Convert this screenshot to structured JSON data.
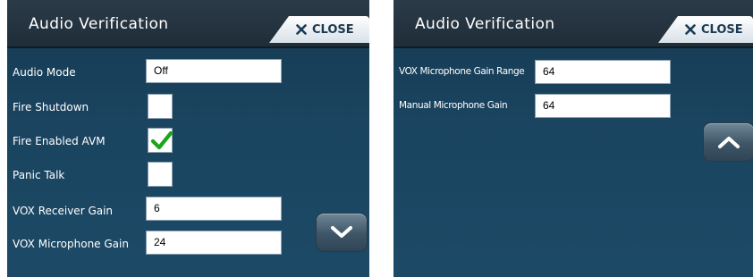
{
  "left_panel": {
    "title": "Audio Verification",
    "close_label": "CLOSE",
    "rows": [
      {
        "label": "Audio Mode",
        "value": "Off"
      },
      {
        "label": "Fire Shutdown",
        "checked": false
      },
      {
        "label": "Fire Enabled AVM",
        "checked": true
      },
      {
        "label": "Panic Talk",
        "checked": false
      },
      {
        "label": "VOX Receiver Gain",
        "value": "6"
      },
      {
        "label": "VOX Microphone Gain",
        "value": "24"
      }
    ],
    "scroll_icon": "chevron-down-icon"
  },
  "right_panel": {
    "title": "Audio Verification",
    "close_label": "CLOSE",
    "rows": [
      {
        "label": "VOX Microphone Gain Range",
        "value": "64"
      },
      {
        "label": "Manual Microphone Gain",
        "value": "64"
      }
    ],
    "scroll_icon": "chevron-up-icon"
  },
  "colors": {
    "background": "#1a4460",
    "title_bar": "#26353f",
    "check_green": "#1aa51a",
    "close_text": "#1a3a52"
  }
}
